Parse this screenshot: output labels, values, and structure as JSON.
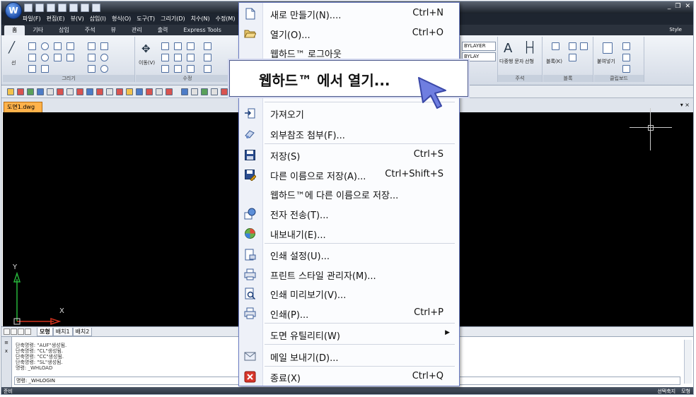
{
  "app": {
    "logo_letter": "W",
    "menubar": [
      "파일(F)",
      "편집(E)",
      "뷰(V)",
      "삽입(I)",
      "형식(O)",
      "도구(T)",
      "그리기(D)",
      "치수(N)",
      "수정(M)"
    ],
    "ribbon_tabs": [
      "홈",
      "기타",
      "삽입",
      "주석",
      "뷰",
      "관리",
      "출력",
      "Express Tools"
    ],
    "style_label": "Style",
    "ribbon_group_draw": "그리기",
    "ribbon_group_modify": "수정",
    "ribbon_group_annot": "주석",
    "ribbon_group_block": "블록",
    "ribbon_group_clip": "클립보드",
    "move_label": "이동(V)",
    "line_label": "선",
    "bylayer1": "BYLAYER",
    "bylayer2": "BYLAY",
    "multiline_text": "다중행 문자",
    "dim_label": "선형",
    "block_label": "블록(K)",
    "paste_label": "붙여넣기"
  },
  "document": {
    "tab_label": "도면1.dwg",
    "close_glyph": "▾ ×"
  },
  "ucs": {
    "x_label": "X",
    "y_label": "Y"
  },
  "layout_tabs": [
    "모형",
    "배치1",
    "배치2"
  ],
  "command": {
    "lines": [
      "단축명령: \"AUF\"생성됨.",
      "단축명령: \"CL\"생성됨.",
      "단축명령: \"CC\"생성됨.",
      "단축명령: \"SL\"생성됨.",
      "명령: _WHLOAD"
    ],
    "current": "명령: _WHLOGIN",
    "side_glyphs": [
      "≡",
      "x"
    ]
  },
  "status": {
    "left": "준비",
    "right": [
      "선택축지",
      "모형"
    ]
  },
  "menu": {
    "items": [
      {
        "label": "새로 만들기(N)....",
        "shortcut": "Ctrl+N",
        "icon": "new-file-icon"
      },
      {
        "label": "열기(O)...",
        "shortcut": "Ctrl+O",
        "icon": "open-folder-icon"
      },
      {
        "label": "웹하드™ 로그아웃",
        "shortcut": "",
        "icon": ""
      },
      {
        "label": "가져오기",
        "shortcut": "",
        "icon": "import-icon"
      },
      {
        "label": "외부참조 첨부(F)...",
        "shortcut": "",
        "icon": "attach-xref-icon"
      },
      {
        "label": "저장(S)",
        "shortcut": "Ctrl+S",
        "icon": "save-icon"
      },
      {
        "label": "다른 이름으로 저장(A)...",
        "shortcut": "Ctrl+Shift+S",
        "icon": "save-as-icon"
      },
      {
        "label": "웹하드™에 다른 이름으로 저장...",
        "shortcut": "",
        "icon": ""
      },
      {
        "label": "전자 전송(T)...",
        "shortcut": "",
        "icon": "etransmit-icon"
      },
      {
        "label": "내보내기(E)...",
        "shortcut": "",
        "icon": "export-icon"
      },
      {
        "label": "인쇄 설정(U)...",
        "shortcut": "",
        "icon": "page-setup-icon"
      },
      {
        "label": "프린트 스타일 관리자(M)...",
        "shortcut": "",
        "icon": "plot-style-icon"
      },
      {
        "label": "인쇄 미리보기(V)...",
        "shortcut": "",
        "icon": "print-preview-icon"
      },
      {
        "label": "인쇄(P)...",
        "shortcut": "Ctrl+P",
        "icon": "print-icon"
      },
      {
        "label": "도면 유틸리티(W)",
        "shortcut": "",
        "icon": ""
      },
      {
        "label": "메일 보내기(D)...",
        "shortcut": "",
        "icon": "mail-icon"
      },
      {
        "label": "종료(X)",
        "shortcut": "Ctrl+Q",
        "icon": "exit-icon"
      }
    ],
    "callout_label": "웹하드™ 에서 열기...",
    "submenu_arrow": "▶"
  }
}
